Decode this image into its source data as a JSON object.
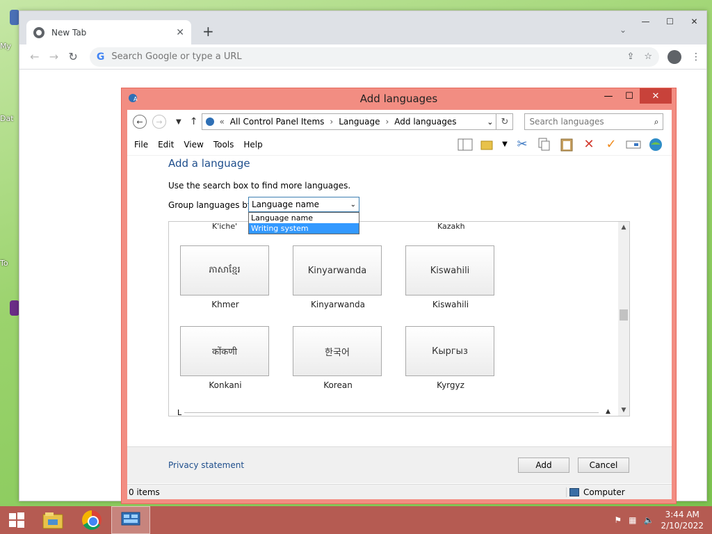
{
  "desktop": {
    "labels": [
      "My",
      "Dat",
      "To"
    ]
  },
  "chrome": {
    "tab_title": "New Tab",
    "omnibox_placeholder": "Search Google or type a URL",
    "icons": [
      "back-arrow-icon",
      "forward-arrow-icon",
      "reload-icon",
      "share-icon",
      "star-icon",
      "profile-icon",
      "menu-dots-icon"
    ]
  },
  "dialog": {
    "title": "Add languages",
    "breadcrumb": [
      "All Control Panel Items",
      "Language",
      "Add languages"
    ],
    "breadcrumb_prefix": "«",
    "search_placeholder": "Search languages",
    "menu": [
      "File",
      "Edit",
      "View",
      "Tools",
      "Help"
    ],
    "heading": "Add a language",
    "hint": "Use the search box to find more languages.",
    "group_label": "Group languages by:",
    "group_value": "Language name",
    "group_options": [
      {
        "label": "Language name",
        "selected": false
      },
      {
        "label": "Writing system",
        "selected": true
      }
    ],
    "top_row": [
      "K'iche'",
      "Kazakh"
    ],
    "languages": [
      {
        "native": "ភាសាខ្មែរ",
        "name": "Khmer"
      },
      {
        "native": "Kinyarwanda",
        "name": "Kinyarwanda"
      },
      {
        "native": "Kiswahili",
        "name": "Kiswahili"
      },
      {
        "native": "कोंकणी",
        "name": "Konkani"
      },
      {
        "native": "한국어",
        "name": "Korean"
      },
      {
        "native": "Кыргыз",
        "name": "Kyrgyz"
      }
    ],
    "next_group_letter": "L",
    "privacy_link": "Privacy statement",
    "add_button": "Add",
    "cancel_button": "Cancel",
    "status_items": "0 items",
    "status_location": "Computer"
  },
  "taskbar": {
    "time": "3:44 AM",
    "date": "2/10/2022"
  },
  "colors": {
    "dialog_frame": "#f28d82",
    "taskbar": "#b55b52",
    "link": "#1e4e8c",
    "selection": "#3399ff"
  }
}
